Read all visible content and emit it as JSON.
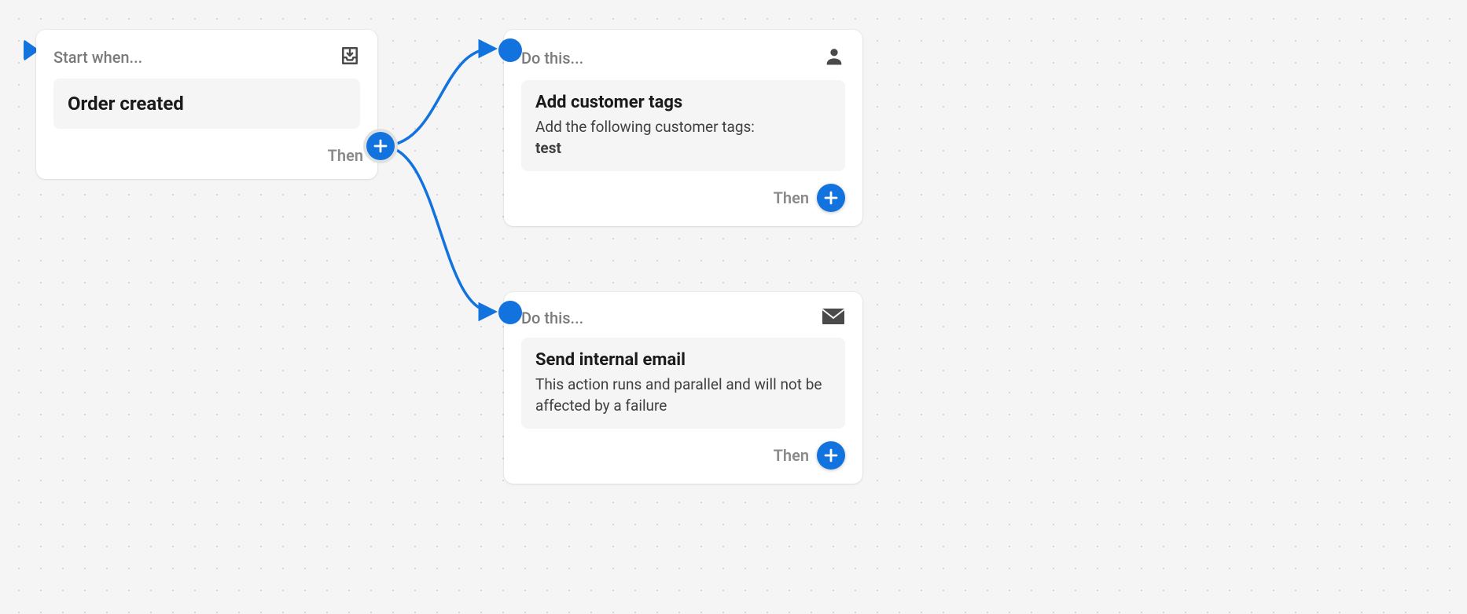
{
  "trigger": {
    "header": "Start when...",
    "title": "Order created",
    "then": "Then"
  },
  "actions": [
    {
      "header": "Do this...",
      "icon": "person",
      "title": "Add customer tags",
      "desc": "Add the following customer tags:",
      "desc_value": "test",
      "then": "Then"
    },
    {
      "header": "Do this...",
      "icon": "mail",
      "title": "Send internal email",
      "desc": "This action runs and parallel and will not be affected by a failure",
      "desc_value": "",
      "then": "Then"
    }
  ]
}
